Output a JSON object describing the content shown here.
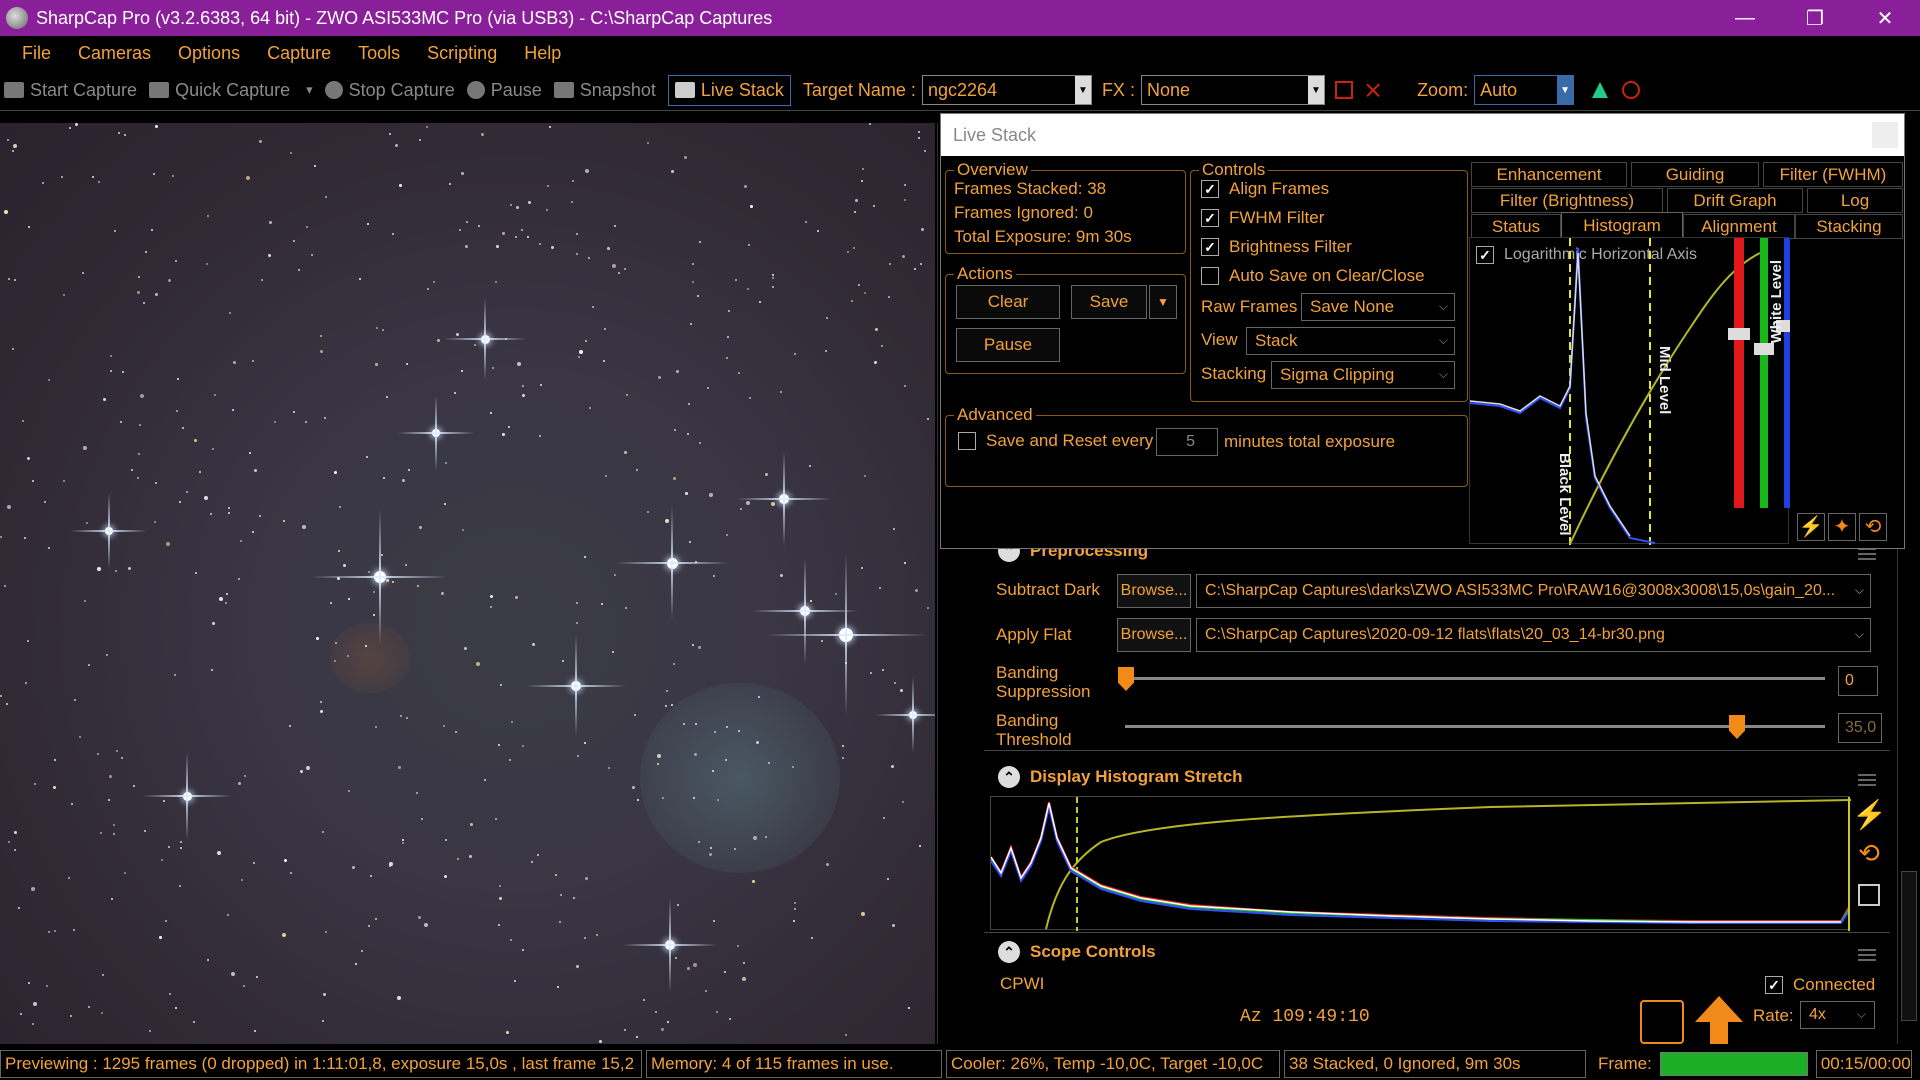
{
  "window": {
    "title": "SharpCap Pro (v3.2.6383, 64 bit) - ZWO ASI533MC Pro (via USB3) - C:\\SharpCap Captures",
    "minimize": "—",
    "maximize": "❐",
    "close": "✕"
  },
  "menu": [
    "File",
    "Cameras",
    "Options",
    "Capture",
    "Tools",
    "Scripting",
    "Help"
  ],
  "toolbar": {
    "start_capture": "Start Capture",
    "quick_capture": "Quick Capture",
    "quick_capture_arrow": "▾",
    "stop_capture": "Stop Capture",
    "pause": "Pause",
    "snapshot": "Snapshot",
    "live_stack": "Live Stack",
    "target_name_label": "Target Name :",
    "target_name_value": "ngc2264",
    "fx_label": "FX :",
    "fx_value": "None",
    "zoom_label": "Zoom:",
    "zoom_value": "Auto",
    "dropdown_glyph": "▼"
  },
  "live_stack": {
    "title": "Live Stack",
    "overview": {
      "title": "Overview",
      "frames_stacked": "Frames Stacked: 38",
      "frames_ignored": "Frames Ignored:  0",
      "total_exposure": "Total Exposure:   9m 30s"
    },
    "actions": {
      "title": "Actions",
      "clear": "Clear",
      "save": "Save",
      "save_arrow": "▼",
      "pause": "Pause"
    },
    "controls": {
      "title": "Controls",
      "align_frames": "Align Frames",
      "fwhm_filter": "FWHM Filter",
      "brightness_filter": "Brightness Filter",
      "auto_save": "Auto Save on Clear/Close",
      "raw_frames_label": "Raw Frames",
      "raw_frames_value": "Save None",
      "view_label": "View",
      "view_value": "Stack",
      "stacking_label": "Stacking",
      "stacking_value": "Sigma Clipping",
      "dd_glyph": "⌵"
    },
    "advanced": {
      "title": "Advanced",
      "save_reset_label": "Save and Reset every",
      "minutes_value": "5",
      "minutes_label": "minutes total exposure"
    },
    "tabs_row1": [
      "Enhancement",
      "Guiding",
      "Filter (FWHM)"
    ],
    "tabs_row2": [
      "Filter (Brightness)",
      "Drift Graph",
      "Log"
    ],
    "tabs_row3": [
      "Status",
      "Histogram",
      "Alignment",
      "Stacking"
    ],
    "histogram": {
      "log_axis_label": "Logarithmic Horizontal Axis",
      "black_level": "Black Level",
      "mid_level": "Mid Level",
      "white_level": "White Level"
    }
  },
  "preprocessing": {
    "title": "Preprocessing",
    "subtract_dark_label": "Subtract Dark",
    "browse": "Browse...",
    "dark_path": "C:\\SharpCap Captures\\darks\\ZWO ASI533MC Pro\\RAW16@3008x3008\\15,0s\\gain_20...",
    "apply_flat_label": "Apply Flat",
    "flat_path": "C:\\SharpCap Captures\\2020-09-12 flats\\flats\\20_03_14-br30.png",
    "banding_suppression_label_1": "Banding",
    "banding_suppression_label_2": "Suppression",
    "banding_suppression_value": "0",
    "banding_threshold_label_1": "Banding",
    "banding_threshold_label_2": "Threshold",
    "banding_threshold_value": "35,0",
    "dd_glyph": "⌵"
  },
  "display_histogram": {
    "title": "Display Histogram Stretch"
  },
  "scope_controls": {
    "title": "Scope Controls",
    "mount_name": "CPWI",
    "connected_label": "Connected",
    "az_readout": "Az  109:49:10",
    "rate_label": "Rate:",
    "rate_value": "4x"
  },
  "statusbar": {
    "previewing": "Previewing : 1295 frames (0 dropped) in 1:11:01,8, exposure 15,0s , last frame 15,2",
    "memory": "Memory: 4 of 115 frames in use.",
    "cooler": "Cooler: 26%, Temp -10,0C, Target -10,0C",
    "stack_status": "38 Stacked, 0 Ignored, 9m 30s",
    "frame_label": "Frame:",
    "frame_time": "00:15/00:00",
    "frame_progress": 1.0
  },
  "colors": {
    "titlebar": "#8a1f9a",
    "accent": "#f2a23a",
    "progress": "#1cae25"
  }
}
